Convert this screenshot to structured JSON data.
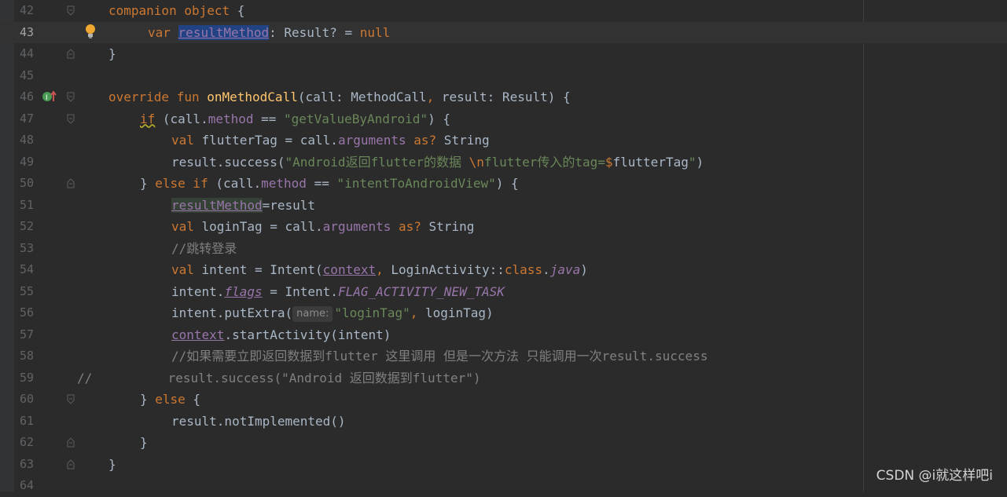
{
  "editor": {
    "lines": [
      {
        "no": "42"
      },
      {
        "no": "43"
      },
      {
        "no": "44"
      },
      {
        "no": "45"
      },
      {
        "no": "46"
      },
      {
        "no": "47"
      },
      {
        "no": "48"
      },
      {
        "no": "49"
      },
      {
        "no": "50"
      },
      {
        "no": "51"
      },
      {
        "no": "52"
      },
      {
        "no": "53"
      },
      {
        "no": "54"
      },
      {
        "no": "55"
      },
      {
        "no": "56"
      },
      {
        "no": "57"
      },
      {
        "no": "58"
      },
      {
        "no": "59"
      },
      {
        "no": "60"
      },
      {
        "no": "61"
      },
      {
        "no": "62"
      },
      {
        "no": "63"
      },
      {
        "no": "64"
      }
    ],
    "tokens": {
      "l42_companion": "companion object",
      "l42_brace": " {",
      "l43_var": "var",
      "l43_name": "resultMethod",
      "l43_type": ": Result? = ",
      "l43_null": "null",
      "l44_brace": "}",
      "l46_override": "override fun",
      "l46_fn": "onMethodCall",
      "l46_params1": "(call: MethodCall",
      "l46_comma": ",",
      "l46_params2": " result: Result) {",
      "l47_if": "if",
      "l47_a": " (call.",
      "l47_method": "method",
      "l47_b": " == ",
      "l47_str": "\"getValueByAndroid\"",
      "l47_c": ") {",
      "l48_val": "val",
      "l48_a": " flutterTag = call.",
      "l48_arguments": "arguments",
      "l48_as": " as?",
      "l48_b": " String",
      "l49_a": "result.success(",
      "l49_str1": "\"Android返回flutter的数据 ",
      "l49_esc": "\\n",
      "l49_str2": "flutter传入的tag=",
      "l49_dollar": "$",
      "l49_var": "flutterTag",
      "l49_str3": "\"",
      "l49_b": ")",
      "l50_a": "} ",
      "l50_else_if": "else if",
      "l50_b": " (call.",
      "l50_method": "method",
      "l50_c": " == ",
      "l50_str": "\"intentToAndroidView\"",
      "l50_d": ") {",
      "l51_name": "resultMethod",
      "l51_a": "=result",
      "l52_val": "val",
      "l52_a": " loginTag = call.",
      "l52_arguments": "arguments",
      "l52_as": " as?",
      "l52_b": " String",
      "l53_cmt": "//跳转登录",
      "l54_val": "val",
      "l54_a": " intent = Intent(",
      "l54_context": "context",
      "l54_comma": ",",
      "l54_b": " LoginActivity::",
      "l54_class": "class",
      "l54_dot": ".",
      "l54_java": "java",
      "l54_c": ")",
      "l55_a": "intent.",
      "l55_flags": "flags",
      "l55_b": " = Intent.",
      "l55_const": "FLAG_ACTIVITY_NEW_TASK",
      "l56_a": "intent.putExtra(",
      "l56_hint": "name:",
      "l56_str": "\"loginTag\"",
      "l56_comma": ",",
      "l56_b": " loginTag)",
      "l57_context": "context",
      "l57_a": ".startActivity(intent)",
      "l58_cmt": "//如果需要立即返回数据到flutter 这里调用 但是一次方法 只能调用一次result.success",
      "l59_cmt": "//          result.success(\"Android 返回数据到flutter\")",
      "l60_a": "} ",
      "l60_else": "else",
      "l60_b": " {",
      "l61_a": "result.notImplemented()",
      "l62_a": "}",
      "l63_a": "}"
    }
  },
  "watermark": "CSDN @i就这样吧i",
  "colors": {
    "background": "#2b2b2b",
    "keyword": "#cc7832",
    "string": "#6a8759",
    "function": "#ffc66d",
    "property": "#9876aa",
    "comment": "#808080",
    "text": "#a9b7c6",
    "selection": "#214283"
  },
  "icons": {
    "line43": "lightbulb-icon",
    "line46": "implements-override-icon"
  }
}
